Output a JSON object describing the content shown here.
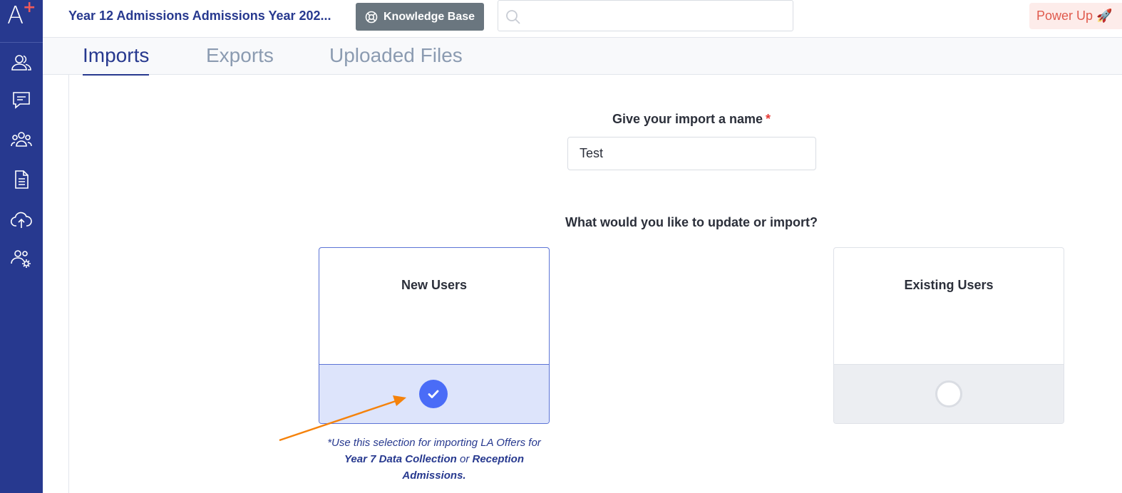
{
  "app": {
    "logo_letter": "A",
    "logo_plus": "+",
    "site_title": "Year 12 Admissions Admissions Year 202...",
    "knowledge_base_label": "Knowledge Base",
    "search_placeholder": "",
    "power_up_label": "Power Up 🚀"
  },
  "sidebar": {
    "items": [
      {
        "icon": "users-icon"
      },
      {
        "icon": "message-icon"
      },
      {
        "icon": "group-icon"
      },
      {
        "icon": "document-icon"
      },
      {
        "icon": "cloud-upload-icon"
      },
      {
        "icon": "user-settings-icon"
      }
    ]
  },
  "tabs": [
    {
      "label": "Imports",
      "active": true
    },
    {
      "label": "Exports",
      "active": false
    },
    {
      "label": "Uploaded Files",
      "active": false
    }
  ],
  "form": {
    "name_label": "Give your import a name",
    "required_marker": "*",
    "name_value": "Test",
    "question": "What would you like to update or import?"
  },
  "options": [
    {
      "title": "New Users",
      "selected": true
    },
    {
      "title": "Existing Users",
      "selected": false
    }
  ],
  "note": {
    "prefix": "*Use this selection for importing LA Offers for ",
    "bold1": "Year 7 Data Collection",
    "middle": " or ",
    "bold2": "Reception Admissions."
  },
  "colors": {
    "sidebar": "#27398f",
    "accent": "#4a6cf7",
    "power_up": "#e05a4d",
    "annotation_arrow": "#f5820b"
  }
}
